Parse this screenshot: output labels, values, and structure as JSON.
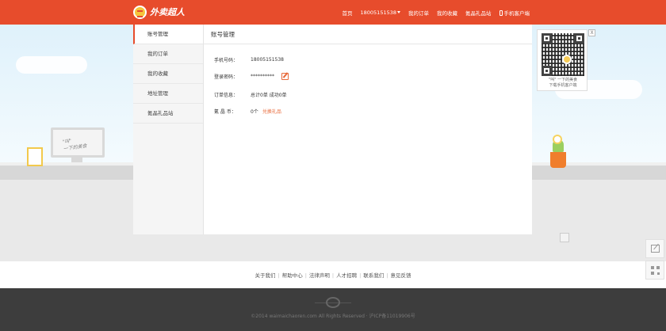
{
  "header": {
    "brand": "外卖超人",
    "nav": {
      "home": "首页",
      "phone": "18005151538",
      "orders": "我的订单",
      "favorites": "我的收藏",
      "gift_shop": "氪晶礼品站",
      "mobile_client": "手机客户端"
    }
  },
  "sidebar": {
    "items": [
      {
        "label": "账号管理",
        "active": true
      },
      {
        "label": "我的订单",
        "active": false
      },
      {
        "label": "我的收藏",
        "active": false
      },
      {
        "label": "地址管理",
        "active": false
      },
      {
        "label": "氪晶礼品站",
        "active": false
      }
    ]
  },
  "main": {
    "title": "账号管理",
    "rows": {
      "phone_label": "手机号码：",
      "phone_value": "18005151538",
      "password_label": "登录密码：",
      "password_value": "**********",
      "order_label": "订单信息：",
      "order_value": "总计0单 成功0单",
      "crystal_label": "氪 晶 币：",
      "crystal_value": "0个",
      "crystal_link": "兑换礼品"
    }
  },
  "qr_card": {
    "caption_line1": "\"叫\" 一下的美食",
    "caption_line2": "下载手机客户端",
    "close": "X"
  },
  "hero": {
    "monitor_text": "\"叫\"\n一下的美食"
  },
  "footer": {
    "links": [
      "关于我们",
      "帮助中心",
      "法律声明",
      "人才招聘",
      "联系我们",
      "意见反馈"
    ],
    "copyright": "©2014 waimaichaoren.com All Rights Reserved · 沪ICP备11019906号"
  },
  "colors": {
    "brand": "#e74c2c",
    "accent": "#e86a3a",
    "footer": "#3d3d3d"
  }
}
